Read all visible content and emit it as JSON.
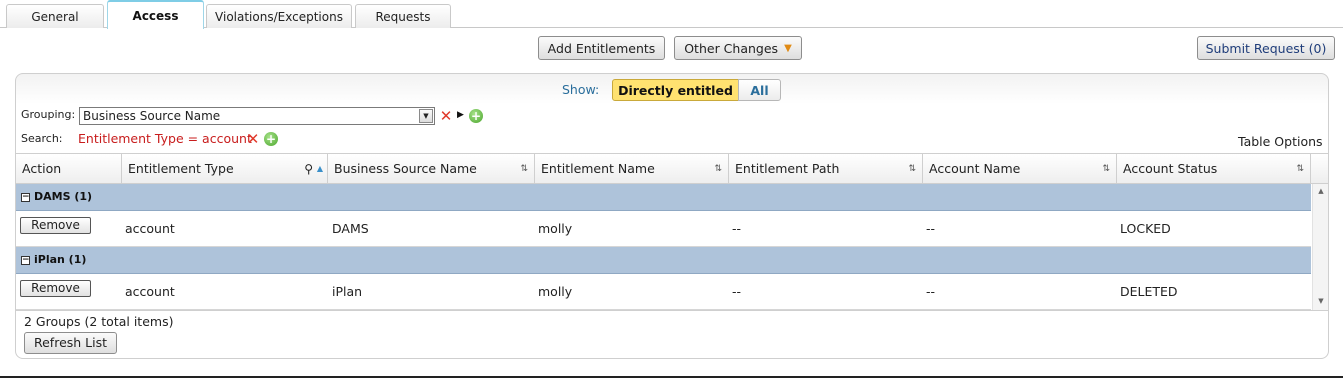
{
  "tabs": [
    "General",
    "Access",
    "Violations/Exceptions",
    "Requests"
  ],
  "toolbar": {
    "add_entitlements": "Add Entitlements",
    "other_changes": "Other Changes",
    "submit_request": "Submit Request (0)"
  },
  "filter": {
    "show_label": "Show:",
    "directly_entitled": "Directly entitled",
    "all": "All",
    "grouping_label": "Grouping:",
    "grouping_value": "Business Source Name",
    "search_label": "Search:",
    "search_filter": "Entitlement Type = account",
    "table_options": "Table Options"
  },
  "table": {
    "columns": [
      "Action",
      "Entitlement Type",
      "Business Source Name",
      "Entitlement Name",
      "Entitlement Path",
      "Account Name",
      "Account Status"
    ],
    "groups": [
      {
        "label": "DAMS (1)",
        "row": {
          "action": "Remove",
          "type": "account",
          "source": "DAMS",
          "name": "molly",
          "path": "--",
          "account": "--",
          "status": "LOCKED"
        }
      },
      {
        "label": "iPlan (1)",
        "row": {
          "action": "Remove",
          "type": "account",
          "source": "iPlan",
          "name": "molly",
          "path": "--",
          "account": "--",
          "status": "DELETED"
        }
      }
    ]
  },
  "footer": {
    "count": "2 Groups (2 total items)",
    "refresh": "Refresh List"
  },
  "colors": {
    "group_row": "#aec3da",
    "show_active": "#ffe270",
    "filter_text": "#c81d1d",
    "tab_accent": "#7fcde6"
  }
}
